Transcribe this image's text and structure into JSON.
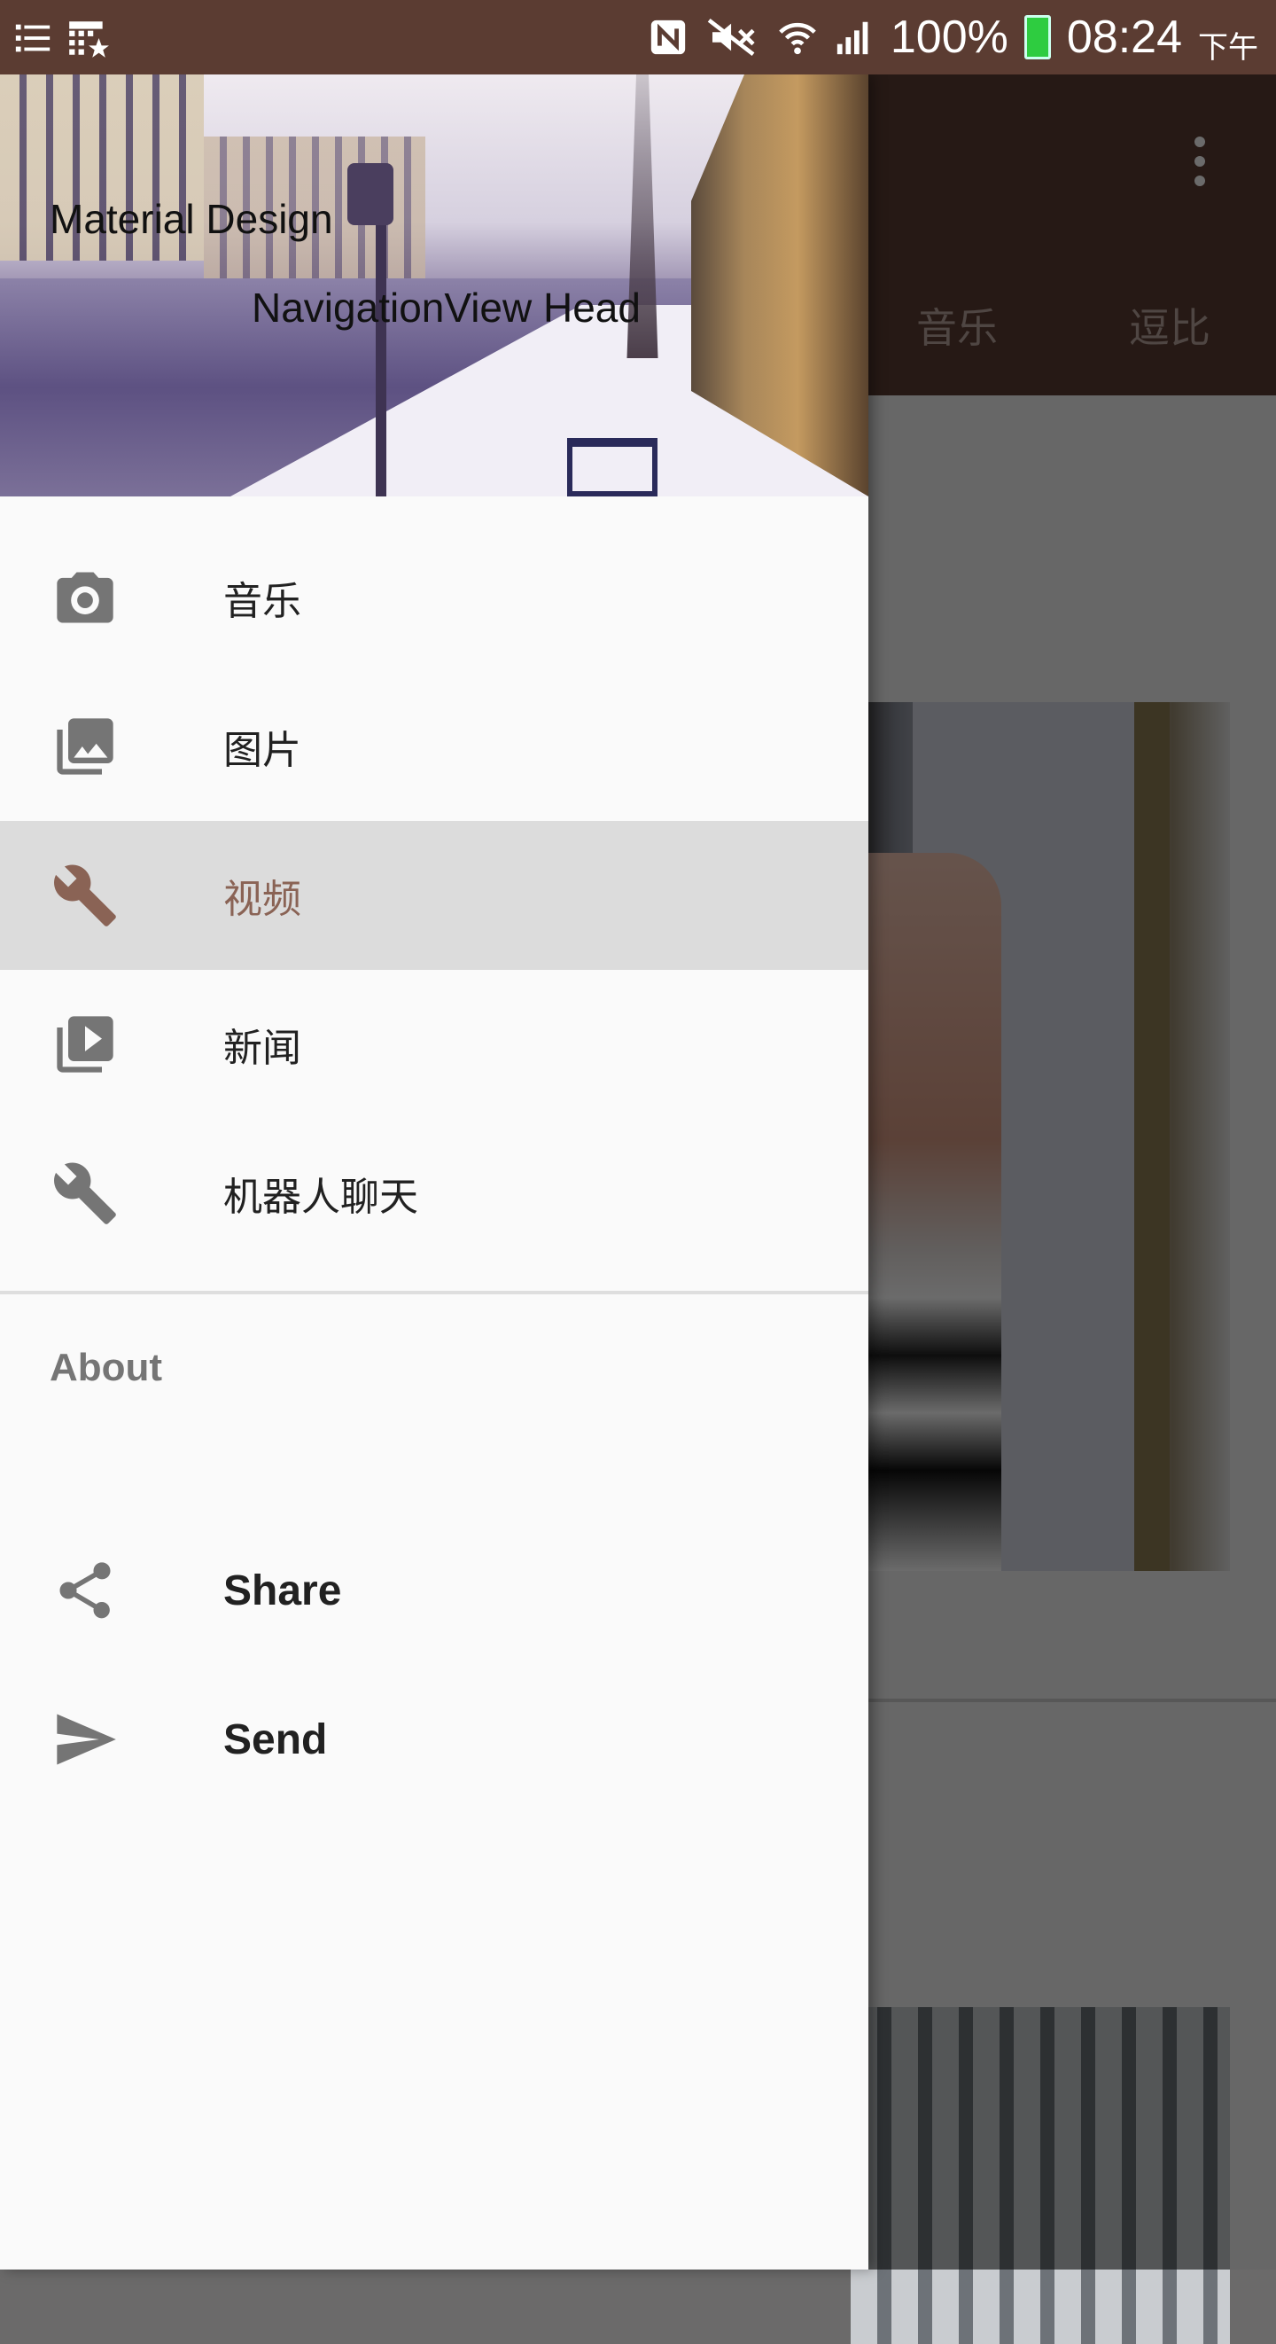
{
  "status_bar": {
    "battery": "100%",
    "time": "08:24",
    "ampm": "下午"
  },
  "app_bar": {
    "tabs": [
      "音乐",
      "逗比"
    ]
  },
  "drawer": {
    "header": {
      "title": "Material Design",
      "subtitle": "NavigationView Head"
    },
    "items": [
      {
        "label": "音乐",
        "icon": "camera-icon"
      },
      {
        "label": "图片",
        "icon": "photo-library-icon"
      },
      {
        "label": "视频",
        "icon": "wrench-icon",
        "selected": true
      },
      {
        "label": "新闻",
        "icon": "video-library-icon"
      },
      {
        "label": "机器人聊天",
        "icon": "wrench-icon"
      }
    ],
    "section_title": "About",
    "about_items": [
      {
        "label": "Share",
        "icon": "share-icon"
      },
      {
        "label": "Send",
        "icon": "send-icon"
      }
    ]
  },
  "colors": {
    "primary_dark": "#5b3c32",
    "selected_text": "#8a6355",
    "selected_bg": "#dcdcdc",
    "icon_gray": "#757575"
  }
}
